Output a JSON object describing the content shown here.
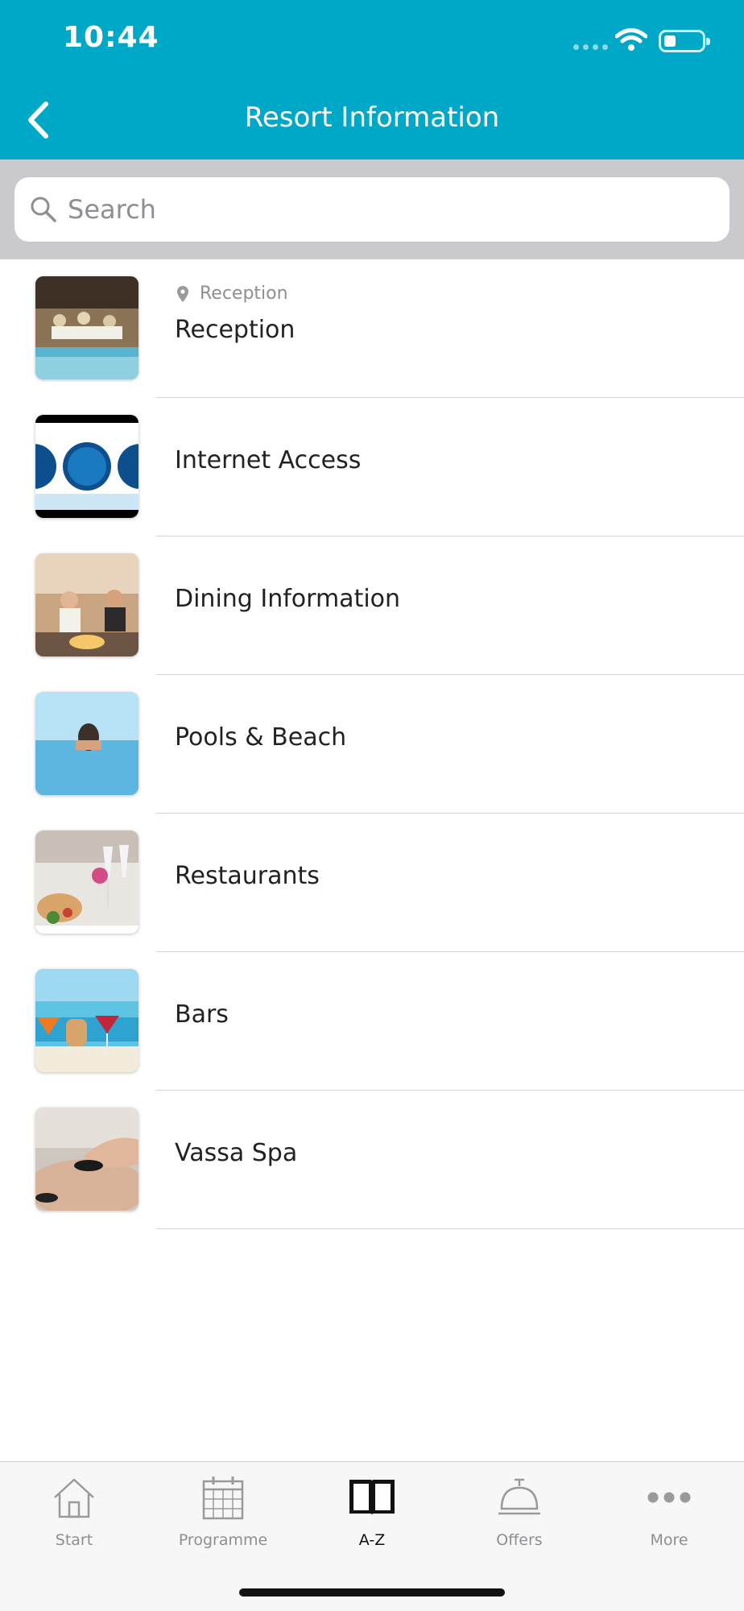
{
  "status_bar": {
    "time": "10:44"
  },
  "header": {
    "title": "Resort Information"
  },
  "search": {
    "placeholder": "Search"
  },
  "items": [
    {
      "label": "Reception",
      "sublabel": "Reception"
    },
    {
      "label": "Internet Access"
    },
    {
      "label": "Dining Information"
    },
    {
      "label": "Pools & Beach"
    },
    {
      "label": "Restaurants"
    },
    {
      "label": "Bars"
    },
    {
      "label": "Vassa Spa"
    }
  ],
  "tabs": [
    {
      "label": "Start",
      "icon": "house-icon",
      "active": false
    },
    {
      "label": "Programme",
      "icon": "calendar-icon",
      "active": false
    },
    {
      "label": "A-Z",
      "icon": "book-icon",
      "active": true
    },
    {
      "label": "Offers",
      "icon": "service-bell-icon",
      "active": false
    },
    {
      "label": "More",
      "icon": "more-dots-icon",
      "active": false
    }
  ],
  "colors": {
    "accent": "#00a8c8",
    "search_area": "#c9c9ce",
    "tab_bar": "#f7f7f7"
  }
}
